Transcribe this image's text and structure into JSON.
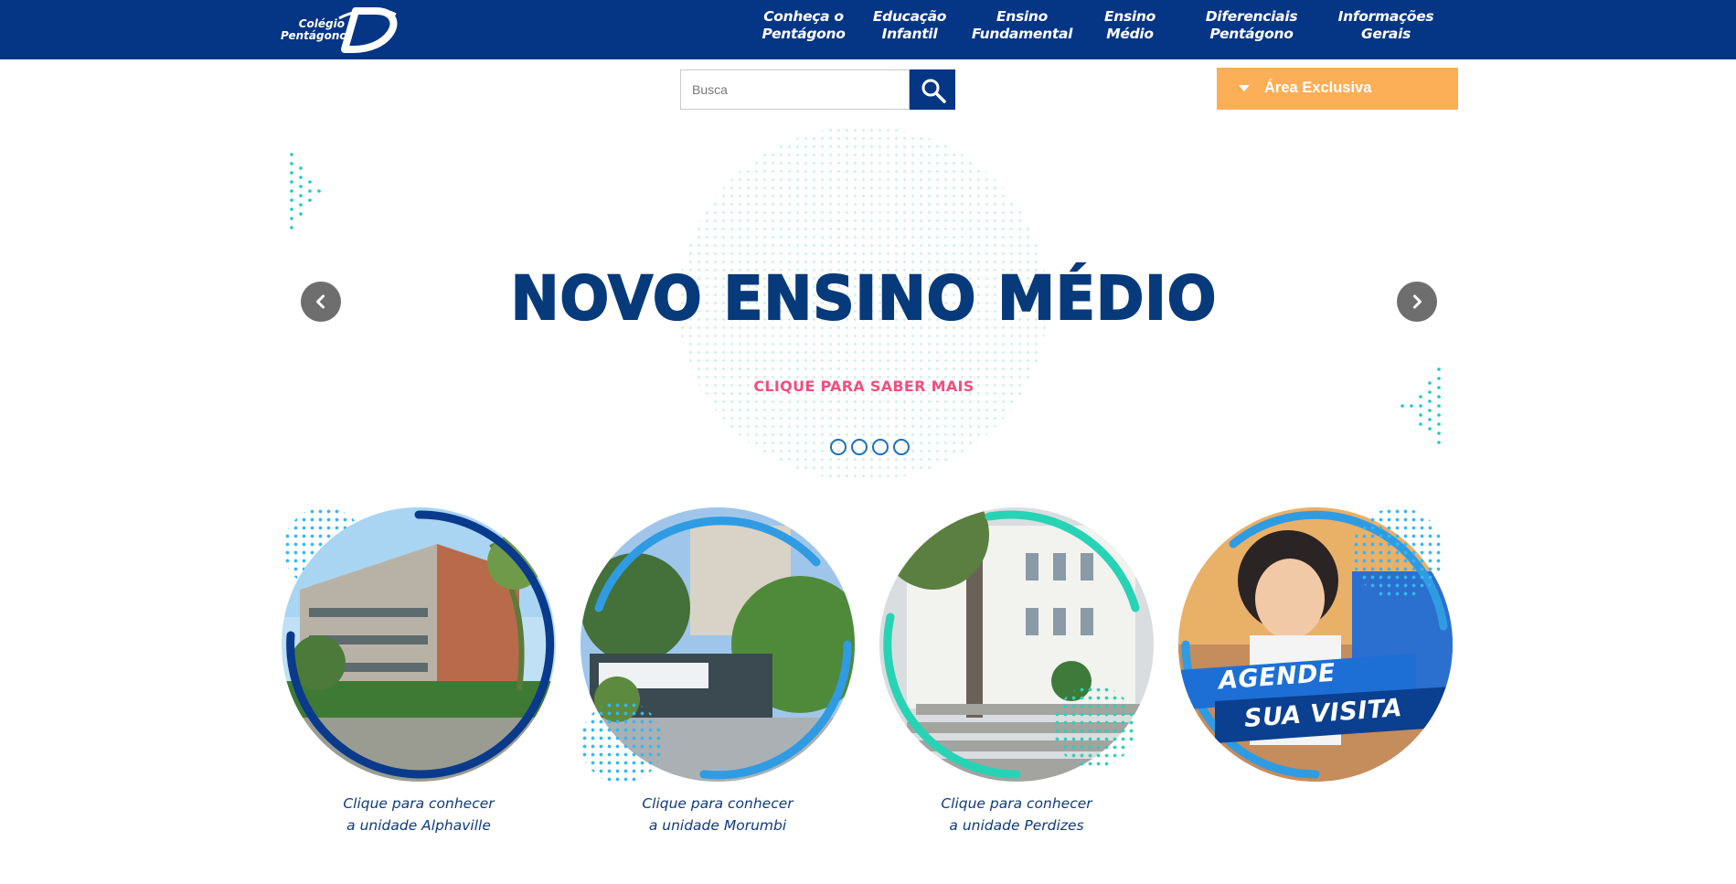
{
  "header": {
    "logo_text": [
      "Colégio",
      "Pentágono"
    ],
    "nav": [
      {
        "lines": [
          "Conheça o",
          "Pentágono"
        ]
      },
      {
        "lines": [
          "Educação",
          "Infantil"
        ]
      },
      {
        "lines": [
          "Ensino",
          "Fundamental"
        ]
      },
      {
        "lines": [
          "Ensino",
          "Médio"
        ]
      },
      {
        "lines": [
          "Diferenciais",
          "Pentágono"
        ]
      },
      {
        "lines": [
          "Informações",
          "Gerais"
        ]
      }
    ]
  },
  "search": {
    "placeholder": "Busca"
  },
  "area_exclusiva": {
    "label": "Área Exclusiva"
  },
  "hero": {
    "title": "NOVO ENSINO MÉDIO",
    "cta": "CLIQUE PARA SABER MAIS",
    "slide_count": 4
  },
  "units": [
    {
      "lines": [
        "Clique para conhecer",
        "a unidade Alphaville"
      ]
    },
    {
      "lines": [
        "Clique para conhecer",
        "a unidade Morumbi"
      ]
    },
    {
      "lines": [
        "Clique para conhecer",
        "a unidade Perdizes"
      ]
    }
  ],
  "visita": {
    "lines": [
      "AGENDE",
      "SUA VISITA"
    ]
  },
  "colors": {
    "header_bg": "#053585",
    "area_btn": "#fcaf56",
    "hero_title": "#073a7a",
    "cta": "#f0507e",
    "ring_dark_blue": "#0a3a8c",
    "ring_blue": "#2f9be3",
    "ring_teal": "#27d3b5"
  },
  "icons": [
    "search-icon",
    "chevron-left-icon",
    "chevron-right-icon",
    "caret-down-icon"
  ]
}
